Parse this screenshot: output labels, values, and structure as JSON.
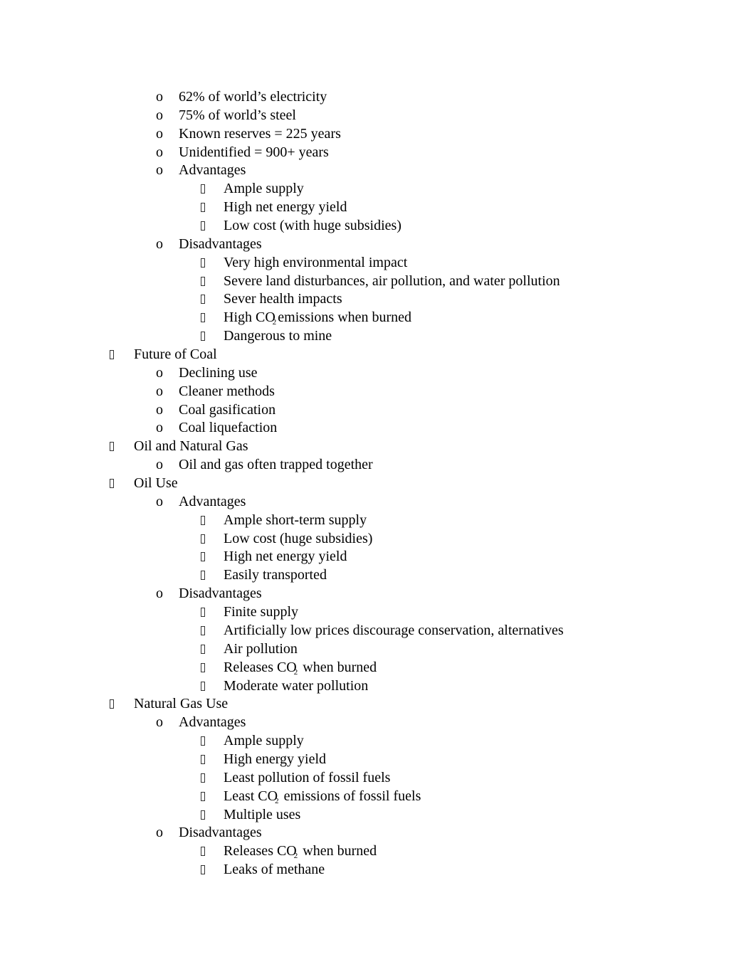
{
  "document": {
    "bullet_glyphs": {
      "level1": "missing-glyph-box",
      "level2": "o",
      "level3": "missing-glyph-box"
    },
    "lines": [
      {
        "level": 2,
        "text": "62% of world’s electricity"
      },
      {
        "level": 2,
        "text": "75% of world’s steel"
      },
      {
        "level": 2,
        "text": "Known reserves = 225 years"
      },
      {
        "level": 2,
        "text": "Unidentified = 900+ years"
      },
      {
        "level": 2,
        "text": "Advantages"
      },
      {
        "level": 3,
        "text": "Ample supply"
      },
      {
        "level": 3,
        "text": "High net energy yield"
      },
      {
        "level": 3,
        "text": "Low cost (with huge subsidies)"
      },
      {
        "level": 2,
        "text": "Disadvantages"
      },
      {
        "level": 3,
        "text": "Very high environmental impact"
      },
      {
        "level": 3,
        "text": "Severe land disturbances, air pollution, and water pollution"
      },
      {
        "level": 3,
        "text": "Sever health impacts"
      },
      {
        "level": 3,
        "text": "High CO",
        "sub": "2",
        "after": "emissions when burned"
      },
      {
        "level": 3,
        "text": "Dangerous to mine"
      },
      {
        "level": 1,
        "text": "Future of Coal"
      },
      {
        "level": 2,
        "text": "Declining use"
      },
      {
        "level": 2,
        "text": "Cleaner methods"
      },
      {
        "level": 2,
        "text": "Coal gasification"
      },
      {
        "level": 2,
        "text": "Coal liquefaction"
      },
      {
        "level": 1,
        "text": "Oil and Natural Gas"
      },
      {
        "level": 2,
        "text": "Oil and gas often trapped together"
      },
      {
        "level": 1,
        "text": "Oil Use"
      },
      {
        "level": 2,
        "text": "Advantages"
      },
      {
        "level": 3,
        "text": "Ample short-term supply"
      },
      {
        "level": 3,
        "text": "Low cost (huge subsidies)"
      },
      {
        "level": 3,
        "text": "High net energy yield"
      },
      {
        "level": 3,
        "text": "Easily transported"
      },
      {
        "level": 2,
        "text": "Disadvantages"
      },
      {
        "level": 3,
        "text": "Finite supply"
      },
      {
        "level": 3,
        "text": "Artificially low prices discourage conservation, alternatives"
      },
      {
        "level": 3,
        "text": "Air pollution"
      },
      {
        "level": 3,
        "text": "Releases CO",
        "sub": "2",
        "after": " when burned"
      },
      {
        "level": 3,
        "text": "Moderate water pollution"
      },
      {
        "level": 1,
        "text": "Natural Gas Use"
      },
      {
        "level": 2,
        "text": "Advantages"
      },
      {
        "level": 3,
        "text": "Ample supply"
      },
      {
        "level": 3,
        "text": "High energy yield"
      },
      {
        "level": 3,
        "text": "Least pollution of fossil fuels"
      },
      {
        "level": 3,
        "text": "Least CO",
        "sub": "2",
        "after": " emissions of fossil fuels"
      },
      {
        "level": 3,
        "text": "Multiple uses"
      },
      {
        "level": 2,
        "text": "Disadvantages"
      },
      {
        "level": 3,
        "text": "Releases CO",
        "sub": "2",
        "after": " when burned"
      },
      {
        "level": 3,
        "text": "Leaks of methane"
      }
    ]
  }
}
